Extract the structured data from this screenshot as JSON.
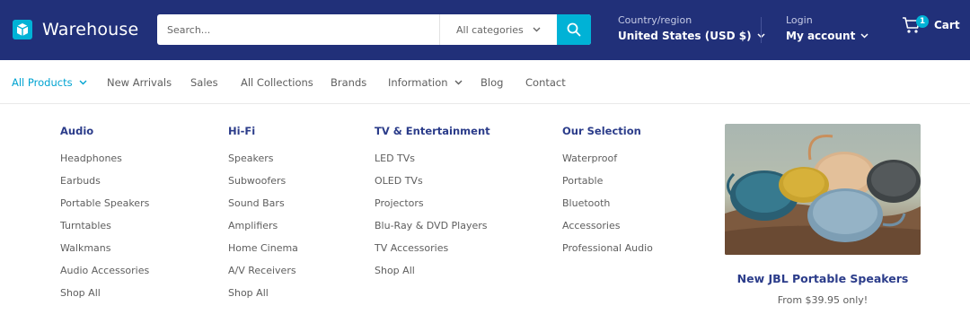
{
  "brand": {
    "name": "Warehouse"
  },
  "search": {
    "placeholder": "Search...",
    "category": "All categories"
  },
  "country": {
    "label": "Country/region",
    "value": "United States (USD $)"
  },
  "account": {
    "label": "Login",
    "value": "My account"
  },
  "cart": {
    "label": "Cart",
    "count": "1"
  },
  "nav": {
    "items": [
      {
        "label": "All Products",
        "active": true
      },
      {
        "label": "New Arrivals"
      },
      {
        "label": "Sales"
      },
      {
        "label": "All Collections"
      },
      {
        "label": "Brands"
      },
      {
        "label": "Information"
      },
      {
        "label": "Blog"
      },
      {
        "label": "Contact"
      }
    ]
  },
  "menu": {
    "columns": [
      {
        "title": "Audio",
        "items": [
          "Headphones",
          "Earbuds",
          "Portable Speakers",
          "Turntables",
          "Walkmans",
          "Audio Accessories",
          "Shop All"
        ]
      },
      {
        "title": "Hi-Fi",
        "items": [
          "Speakers",
          "Subwoofers",
          "Sound Bars",
          "Amplifiers",
          "Home Cinema",
          "A/V Receivers",
          "Shop All"
        ]
      },
      {
        "title": "TV & Entertainment",
        "items": [
          "LED TVs",
          "OLED TVs",
          "Projectors",
          "Blu-Ray & DVD Players",
          "TV Accessories",
          "Shop All"
        ]
      },
      {
        "title": "Our Selection",
        "items": [
          "Waterproof",
          "Portable",
          "Bluetooth",
          "Accessories",
          "Professional Audio"
        ]
      }
    ],
    "promo": {
      "title": "New JBL Portable Speakers",
      "price": "From $39.95 only!"
    }
  },
  "colors": {
    "header_bg": "#213079",
    "accent": "#00b2d6",
    "heading": "#2b3c8a"
  }
}
